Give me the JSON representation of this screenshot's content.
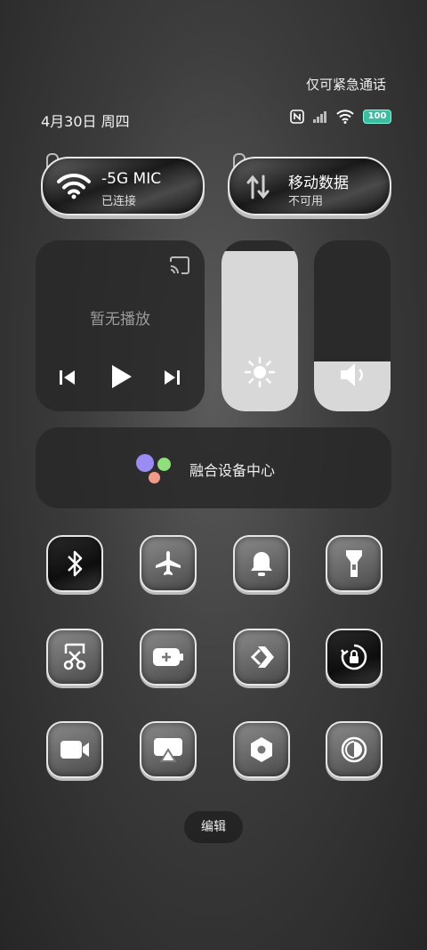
{
  "status": {
    "emergency": "仅可紧急通话",
    "date": "4月30日 周四",
    "battery": "100"
  },
  "wifi": {
    "name": "-5G    MIC",
    "state": "已连接"
  },
  "mobile": {
    "name": "移动数据",
    "state": "不可用"
  },
  "media": {
    "title": "暂无播放"
  },
  "brightness": {
    "level": 0.94
  },
  "volume": {
    "level": 0.29
  },
  "fusion": {
    "label": "融合设备中心"
  },
  "toggles": [
    "bluetooth",
    "airplane",
    "bell",
    "flashlight",
    "screenshot",
    "battery-saver",
    "nearby-share",
    "rotation-lock",
    "screen-record",
    "cast",
    "settings-hex",
    "dark-mode"
  ],
  "edit": "编辑"
}
